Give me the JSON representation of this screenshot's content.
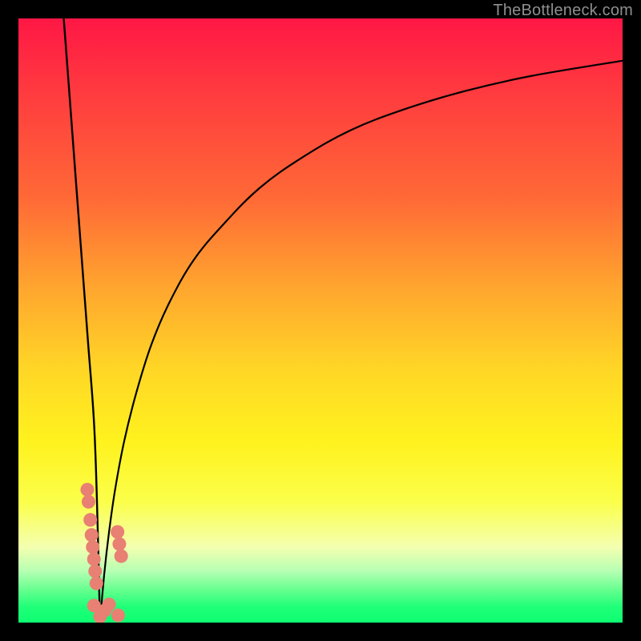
{
  "watermark": "TheBottleneck.com",
  "colors": {
    "curve": "#000000",
    "point_fill": "#e88073",
    "point_stroke": "#d86a5f"
  },
  "chart_data": {
    "type": "line",
    "title": "",
    "xlabel": "",
    "ylabel": "",
    "xlim": [
      0,
      100
    ],
    "ylim": [
      0,
      100
    ],
    "grid": false,
    "legend": false,
    "notch_x": 13.5,
    "series": [
      {
        "name": "left-slope",
        "x": [
          7.5,
          8.5,
          9.5,
          10.5,
          11.5,
          12.5,
          13.0,
          13.5
        ],
        "y": [
          100,
          86.7,
          73.3,
          60.0,
          46.7,
          33.3,
          20.0,
          0
        ]
      },
      {
        "name": "right-curve",
        "x": [
          13.5,
          14.2,
          15,
          16,
          17.5,
          19.5,
          22,
          25,
          29,
          34,
          40,
          47,
          55,
          64,
          74,
          85,
          100
        ],
        "y": [
          0,
          8,
          15,
          22,
          30,
          38,
          46,
          53,
          60,
          66,
          72,
          77,
          81.5,
          85,
          88,
          90.5,
          93
        ]
      }
    ],
    "points": [
      {
        "x": 11.4,
        "y": 22.0,
        "r": 1.2
      },
      {
        "x": 11.6,
        "y": 20.0,
        "r": 1.2
      },
      {
        "x": 11.9,
        "y": 17.0,
        "r": 1.2
      },
      {
        "x": 12.1,
        "y": 14.5,
        "r": 1.2
      },
      {
        "x": 12.3,
        "y": 12.5,
        "r": 1.2
      },
      {
        "x": 12.5,
        "y": 10.5,
        "r": 1.2
      },
      {
        "x": 12.7,
        "y": 8.5,
        "r": 1.2
      },
      {
        "x": 12.9,
        "y": 6.5,
        "r": 1.2
      },
      {
        "x": 12.5,
        "y": 2.8,
        "r": 1.2
      },
      {
        "x": 13.5,
        "y": 1.0,
        "r": 1.2
      },
      {
        "x": 14.3,
        "y": 2.0,
        "r": 1.2
      },
      {
        "x": 15.0,
        "y": 3.0,
        "r": 1.2
      },
      {
        "x": 16.5,
        "y": 1.2,
        "r": 1.2
      },
      {
        "x": 16.4,
        "y": 15.0,
        "r": 1.2
      },
      {
        "x": 16.7,
        "y": 13.0,
        "r": 1.2
      },
      {
        "x": 17.0,
        "y": 11.0,
        "r": 1.2
      }
    ]
  }
}
